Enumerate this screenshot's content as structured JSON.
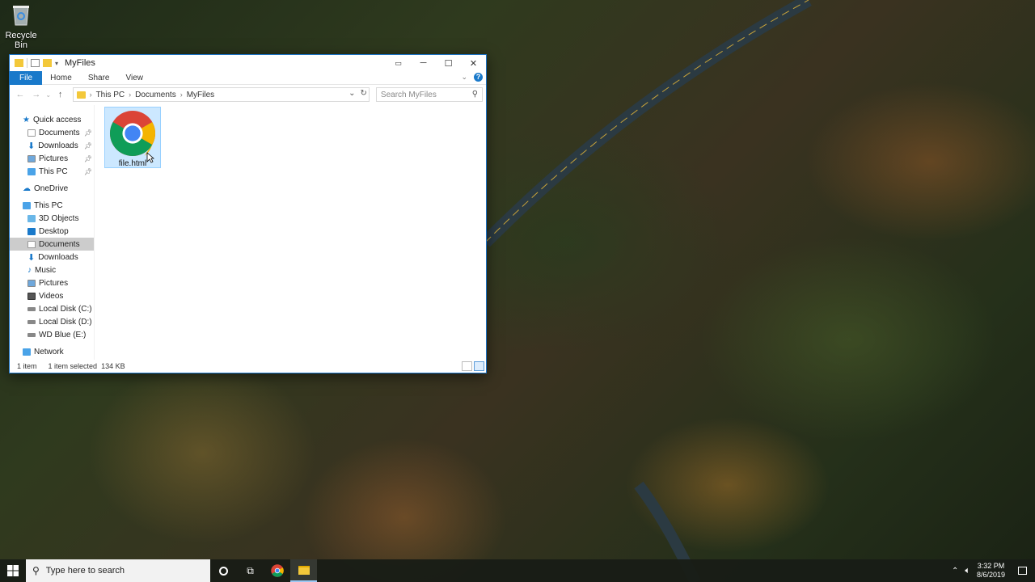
{
  "desktop": {
    "recycle_bin_label": "Recycle Bin"
  },
  "window": {
    "title": "MyFiles",
    "ribbon_tabs": [
      "File",
      "Home",
      "Share",
      "View"
    ],
    "breadcrumb": [
      "This PC",
      "Documents",
      "MyFiles"
    ],
    "search_placeholder": "Search MyFiles",
    "sidebar": {
      "quick_access": "Quick access",
      "quick_items": [
        "Documents",
        "Downloads",
        "Pictures",
        "This PC"
      ],
      "onedrive": "OneDrive",
      "this_pc": "This PC",
      "pc_items": [
        "3D Objects",
        "Desktop",
        "Documents",
        "Downloads",
        "Music",
        "Pictures",
        "Videos",
        "Local Disk (C:)",
        "Local Disk (D:)",
        "WD Blue (E:)"
      ],
      "network": "Network",
      "selected": "Documents"
    },
    "file": {
      "name": "file.html"
    },
    "status": {
      "count": "1 item",
      "selected": "1 item selected",
      "size": "134 KB"
    }
  },
  "taskbar": {
    "search_placeholder": "Type here to search",
    "time": "3:32 PM",
    "date": "8/6/2019"
  },
  "colors": {
    "accent": "#1979ca",
    "selection": "#cce8ff",
    "folder": "#f3c83a"
  }
}
